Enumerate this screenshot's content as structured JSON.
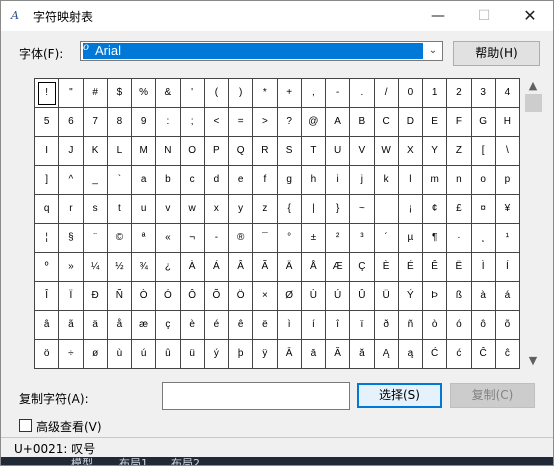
{
  "window": {
    "title": "字符映射表",
    "minimize": "—",
    "maximize": "☐",
    "close": "✕"
  },
  "font": {
    "label": "字体(F):",
    "selected": "Arial",
    "open_type_badge": "o"
  },
  "buttons": {
    "help": "帮助(H)",
    "select": "选择(S)",
    "copy": "复制(C)"
  },
  "copy_field": {
    "label": "复制字符(A):",
    "value": ""
  },
  "advanced": {
    "label": "高级查看(V)",
    "checked": false
  },
  "status": "U+0021: 叹号",
  "taskbar": [
    "模型",
    "布局1",
    "布局2"
  ],
  "grid": {
    "columns": 20,
    "rows": 10,
    "selected_index": 0,
    "chars": [
      "!",
      "\"",
      "#",
      "$",
      "%",
      "&",
      "'",
      "(",
      ")",
      "*",
      "+",
      ",",
      "-",
      ".",
      "/",
      "0",
      "1",
      "2",
      "3",
      "4",
      "5",
      "6",
      "7",
      "8",
      "9",
      ":",
      ";",
      "<",
      "=",
      ">",
      "?",
      "@",
      "A",
      "B",
      "C",
      "D",
      "E",
      "F",
      "G",
      "H",
      "I",
      "J",
      "K",
      "L",
      "M",
      "N",
      "O",
      "P",
      "Q",
      "R",
      "S",
      "T",
      "U",
      "V",
      "W",
      "X",
      "Y",
      "Z",
      "[",
      "\\",
      "]",
      "^",
      "_",
      "`",
      "a",
      "b",
      "c",
      "d",
      "e",
      "f",
      "g",
      "h",
      "i",
      "j",
      "k",
      "l",
      "m",
      "n",
      "o",
      "p",
      "q",
      "r",
      "s",
      "t",
      "u",
      "v",
      "w",
      "x",
      "y",
      "z",
      "{",
      "|",
      "}",
      "~",
      " ",
      "¡",
      "¢",
      "£",
      "¤",
      "¥",
      "¦",
      "§",
      "¨",
      "©",
      "ª",
      "«",
      "¬",
      "-",
      "®",
      "¯",
      "°",
      "±",
      "²",
      "³",
      "´",
      "µ",
      "¶",
      "·",
      "¸",
      "¹",
      "º",
      "»",
      "¼",
      "½",
      "¾",
      "¿",
      "À",
      "Á",
      "Â",
      "Ã",
      "Ä",
      "Å",
      "Æ",
      "Ç",
      "È",
      "É",
      "Ê",
      "Ë",
      "Ì",
      "Í",
      "Î",
      "Ï",
      "Ð",
      "Ñ",
      "Ò",
      "Ó",
      "Ô",
      "Õ",
      "Ö",
      "×",
      "Ø",
      "Ù",
      "Ú",
      "Û",
      "Ü",
      "Ý",
      "Þ",
      "ß",
      "à",
      "á",
      "â",
      "ã",
      "ä",
      "å",
      "æ",
      "ç",
      "è",
      "é",
      "ê",
      "ë",
      "ì",
      "í",
      "î",
      "ï",
      "ð",
      "ñ",
      "ò",
      "ó",
      "ô",
      "õ",
      "ö",
      "÷",
      "ø",
      "ù",
      "ú",
      "û",
      "ü",
      "ý",
      "þ",
      "ÿ",
      "Ā",
      "ā",
      "Ă",
      "ă",
      "Ą",
      "ą",
      "Ć",
      "ć",
      "Ĉ",
      "ĉ"
    ]
  },
  "scrollbar": {
    "up_arrow": "▲",
    "down_arrow": "▼"
  },
  "colors": {
    "selection": "#0078d7",
    "window_bg": "#f0f0f0"
  }
}
